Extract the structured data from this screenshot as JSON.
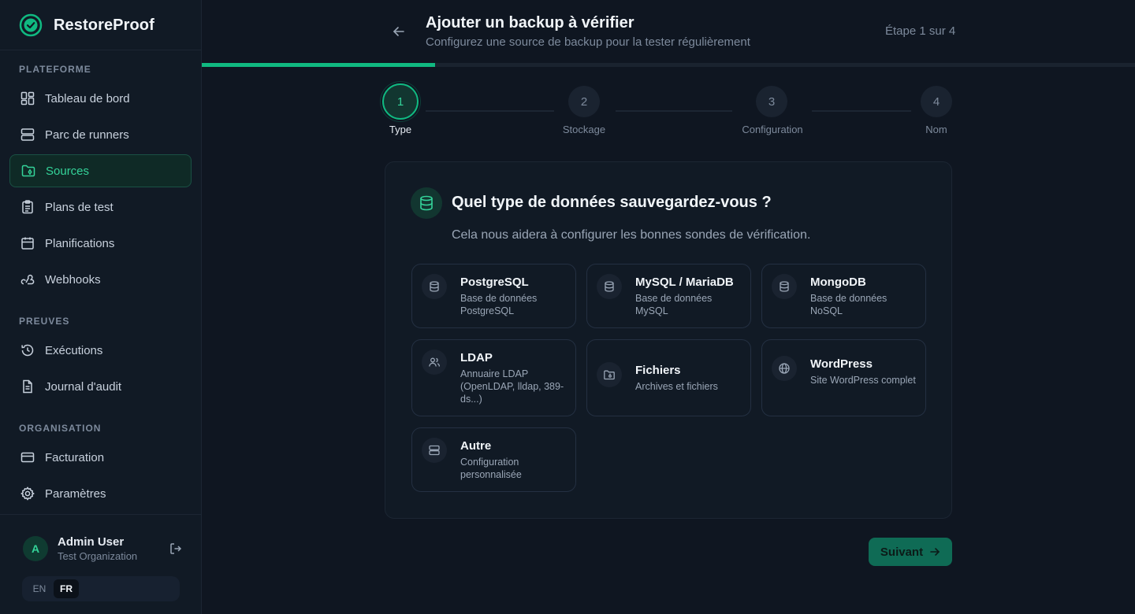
{
  "app": {
    "name": "RestoreProof"
  },
  "sidebar": {
    "sections": [
      {
        "label": "PLATEFORME"
      },
      {
        "label": "PREUVES"
      },
      {
        "label": "ORGANISATION"
      }
    ],
    "items": [
      {
        "label": "Tableau de bord",
        "icon": "dashboard-icon"
      },
      {
        "label": "Parc de runners",
        "icon": "server-icon"
      },
      {
        "label": "Sources",
        "icon": "folder-git-icon",
        "active": true
      },
      {
        "label": "Plans de test",
        "icon": "clipboard-list-icon"
      },
      {
        "label": "Planifications",
        "icon": "calendar-icon"
      },
      {
        "label": "Webhooks",
        "icon": "webhook-icon"
      },
      {
        "label": "Exécutions",
        "icon": "history-icon"
      },
      {
        "label": "Journal d'audit",
        "icon": "file-text-icon"
      },
      {
        "label": "Facturation",
        "icon": "credit-card-icon"
      },
      {
        "label": "Paramètres",
        "icon": "gear-icon"
      }
    ],
    "user": {
      "initial": "A",
      "name": "Admin User",
      "org": "Test Organization"
    },
    "languages": [
      {
        "code": "EN",
        "active": false
      },
      {
        "code": "FR",
        "active": true
      }
    ]
  },
  "header": {
    "title": "Ajouter un backup à vérifier",
    "subtitle": "Configurez une source de backup pour la tester régulièrement",
    "step_counter": "Étape 1 sur 4",
    "progress_fraction": 0.25
  },
  "stepper": [
    {
      "number": "1",
      "label": "Type",
      "active": true
    },
    {
      "number": "2",
      "label": "Stockage",
      "active": false
    },
    {
      "number": "3",
      "label": "Configuration",
      "active": false
    },
    {
      "number": "4",
      "label": "Nom",
      "active": false
    }
  ],
  "card": {
    "title": "Quel type de données sauvegardez-vous ?",
    "subtitle": "Cela nous aidera à configurer les bonnes sondes de vérification.",
    "options": [
      {
        "title": "PostgreSQL",
        "description": "Base de données PostgreSQL",
        "icon": "database-icon"
      },
      {
        "title": "MySQL / MariaDB",
        "description": "Base de données MySQL",
        "icon": "database-icon"
      },
      {
        "title": "MongoDB",
        "description": "Base de données NoSQL",
        "icon": "database-icon"
      },
      {
        "title": "LDAP",
        "description": "Annuaire LDAP (OpenLDAP, lldap, 389-ds...)",
        "icon": "users-icon"
      },
      {
        "title": "Fichiers",
        "description": "Archives et fichiers",
        "icon": "folder-archive-icon"
      },
      {
        "title": "WordPress",
        "description": "Site WordPress complet",
        "icon": "globe-icon"
      },
      {
        "title": "Autre",
        "description": "Configuration personnalisée",
        "icon": "server-icon"
      }
    ]
  },
  "actions": {
    "next_label": "Suivant"
  }
}
